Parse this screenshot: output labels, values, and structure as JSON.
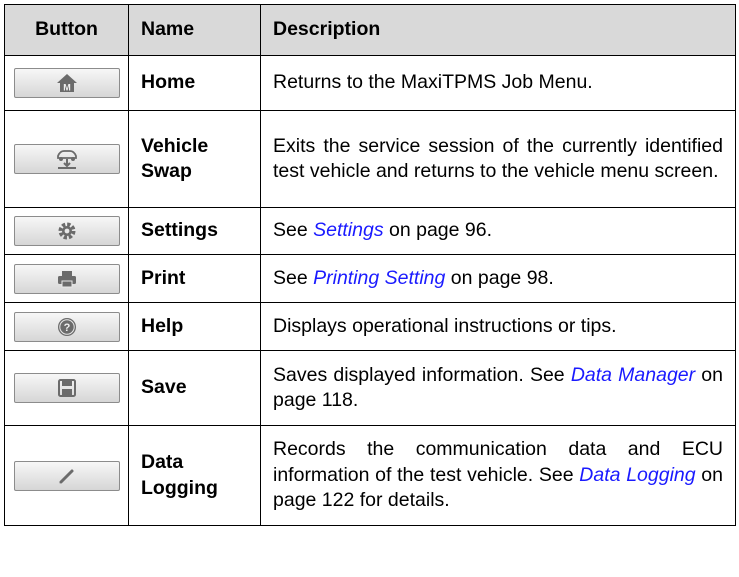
{
  "header": {
    "col1": "Button",
    "col2": "Name",
    "col3": "Description"
  },
  "rows": [
    {
      "icon": "home-icon",
      "name": "Home",
      "desc_plain": "Returns to the MaxiTPMS Job Menu."
    },
    {
      "icon": "vehicle-swap-icon",
      "name_line1": "Vehicle",
      "name_line2": "Swap",
      "desc_plain": "Exits the service session of the currently identified test vehicle and returns to the vehicle menu screen."
    },
    {
      "icon": "gear-icon",
      "name": "Settings",
      "desc_pre": "See ",
      "desc_link": "Settings",
      "desc_post": " on page 96."
    },
    {
      "icon": "printer-icon",
      "name": "Print",
      "desc_pre": "See ",
      "desc_link": "Printing Setting",
      "desc_post": " on page 98."
    },
    {
      "icon": "help-icon",
      "name": "Help",
      "desc_plain": "Displays operational instructions or tips."
    },
    {
      "icon": "save-icon",
      "name": "Save",
      "desc_pre": "Saves displayed information. See ",
      "desc_link": "Data Manager",
      "desc_post": " on page 118."
    },
    {
      "icon": "pencil-icon",
      "name_line1": "Data",
      "name_line2": "Logging",
      "desc_pre": "Records the communication data and ECU information of the test vehicle. See ",
      "desc_link": "Data Logging",
      "desc_post": " on page 122 for details."
    }
  ]
}
